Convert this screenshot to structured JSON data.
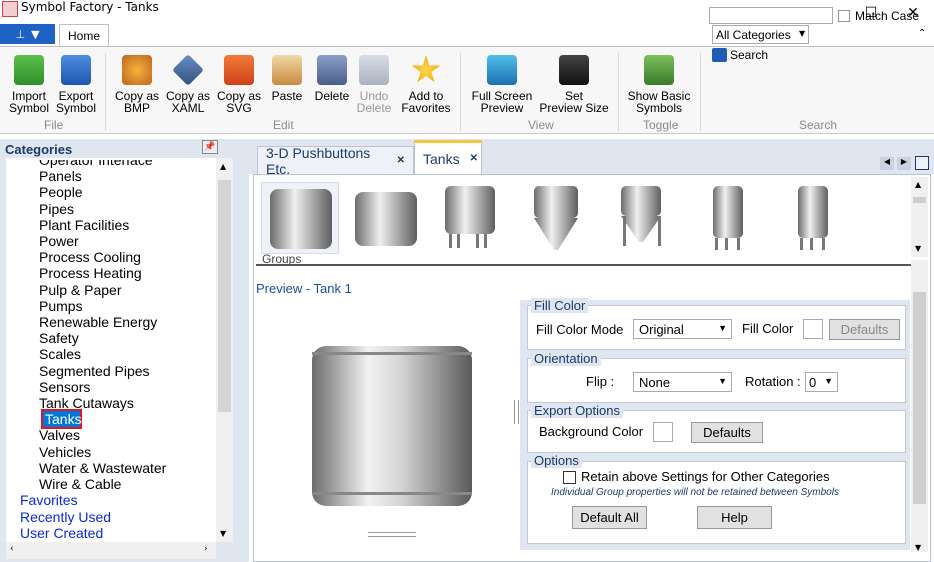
{
  "window": {
    "title": "Symbol Factory - Tanks",
    "minimize": "—",
    "maximize": "☐",
    "close": "✕"
  },
  "ribbon": {
    "home_tab": "Home",
    "groups": {
      "file": "File",
      "edit": "Edit",
      "view": "View",
      "toggle": "Toggle",
      "search": "Search"
    },
    "buttons": {
      "import": [
        "Import",
        "Symbol"
      ],
      "export": [
        "Export",
        "Symbol"
      ],
      "copy_bmp": [
        "Copy as",
        "BMP"
      ],
      "copy_xaml": [
        "Copy as",
        "XAML"
      ],
      "copy_svg": [
        "Copy as",
        "SVG"
      ],
      "paste": "Paste",
      "delete": "Delete",
      "undo": [
        "Undo",
        "Delete"
      ],
      "favorites": [
        "Add to",
        "Favorites"
      ],
      "fullscreen": [
        "Full Screen",
        "Preview"
      ],
      "preview_size": [
        "Set",
        "Preview Size"
      ],
      "basic": [
        "Show Basic",
        "Symbols"
      ]
    },
    "search": {
      "value": "",
      "match_case": "Match Case",
      "category": "All Categories",
      "button": "Search"
    }
  },
  "sidebar": {
    "header": "Categories",
    "items": [
      "Operator Interface",
      "Panels",
      "People",
      "Pipes",
      "Plant Facilities",
      "Power",
      "Process Cooling",
      "Process Heating",
      "Pulp & Paper",
      "Pumps",
      "Renewable Energy",
      "Safety",
      "Scales",
      "Segmented Pipes",
      "Sensors",
      "Tank Cutaways",
      "Tanks",
      "Valves",
      "Vehicles",
      "Water & Wastewater",
      "Wire & Cable"
    ],
    "top_items": [
      "Favorites",
      "Recently Used",
      "User Created"
    ],
    "selected": "Tanks"
  },
  "doc_tabs": [
    "3-D Pushbuttons Etc.",
    "Tanks"
  ],
  "groups_label": "Groups",
  "preview": {
    "label": "Preview - Tank 1"
  },
  "props": {
    "fill": {
      "title": "Fill Color",
      "mode_label": "Fill Color Mode",
      "mode_value": "Original",
      "color_label": "Fill Color",
      "defaults": "Defaults"
    },
    "orientation": {
      "title": "Orientation",
      "flip_label": "Flip :",
      "flip_value": "None",
      "rotation_label": "Rotation :",
      "rotation_value": "0"
    },
    "export": {
      "title": "Export Options",
      "bg_label": "Background Color",
      "defaults": "Defaults"
    },
    "options": {
      "title": "Options",
      "retain_label": "Retain above Settings for Other Categories",
      "note": "Individual Group properties will not be retained between Symbols",
      "default_all": "Default All",
      "help": "Help"
    }
  },
  "colors": {
    "accent": "#1e63c4",
    "selection": "#0078d7",
    "selection_border": "#e0171f",
    "panel": "#dfe6f0"
  }
}
